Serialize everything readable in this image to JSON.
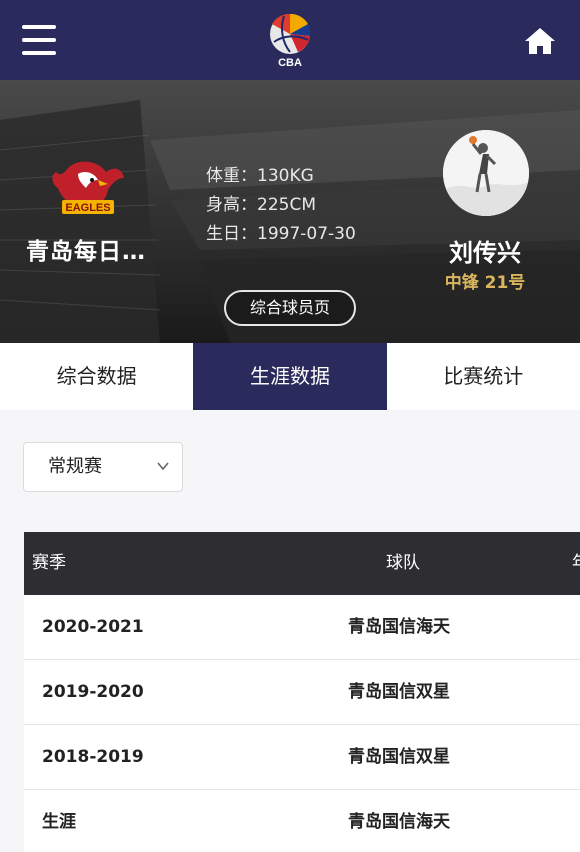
{
  "header": {
    "logo_text": "CBA",
    "menu_icon": "hamburger-menu-icon",
    "home_icon": "home-icon"
  },
  "player": {
    "team_name": "青岛每日…",
    "team_logo_text": "EAGLES",
    "weight": "体重：130KG",
    "height": "身高：225CM",
    "birthday": "生日：1997-07-30",
    "name": "刘传兴",
    "position": "中锋 21号",
    "profile_button": "综合球员页"
  },
  "tabs": [
    {
      "label": "综合数据",
      "active": false
    },
    {
      "label": "生涯数据",
      "active": true
    },
    {
      "label": "比赛统计",
      "active": false
    }
  ],
  "filter": {
    "selected": "常规赛"
  },
  "table": {
    "headers": [
      "赛季",
      "球队",
      "年"
    ],
    "rows": [
      {
        "season": "2020-2021",
        "team": "青岛国信海天"
      },
      {
        "season": "2019-2020",
        "team": "青岛国信双星"
      },
      {
        "season": "2018-2019",
        "team": "青岛国信双星"
      },
      {
        "season": "生涯",
        "team": "青岛国信海天"
      }
    ]
  },
  "colors": {
    "primary": "#2b2a5c",
    "gold": "#d9b55c",
    "table_header": "#2e2d31"
  }
}
